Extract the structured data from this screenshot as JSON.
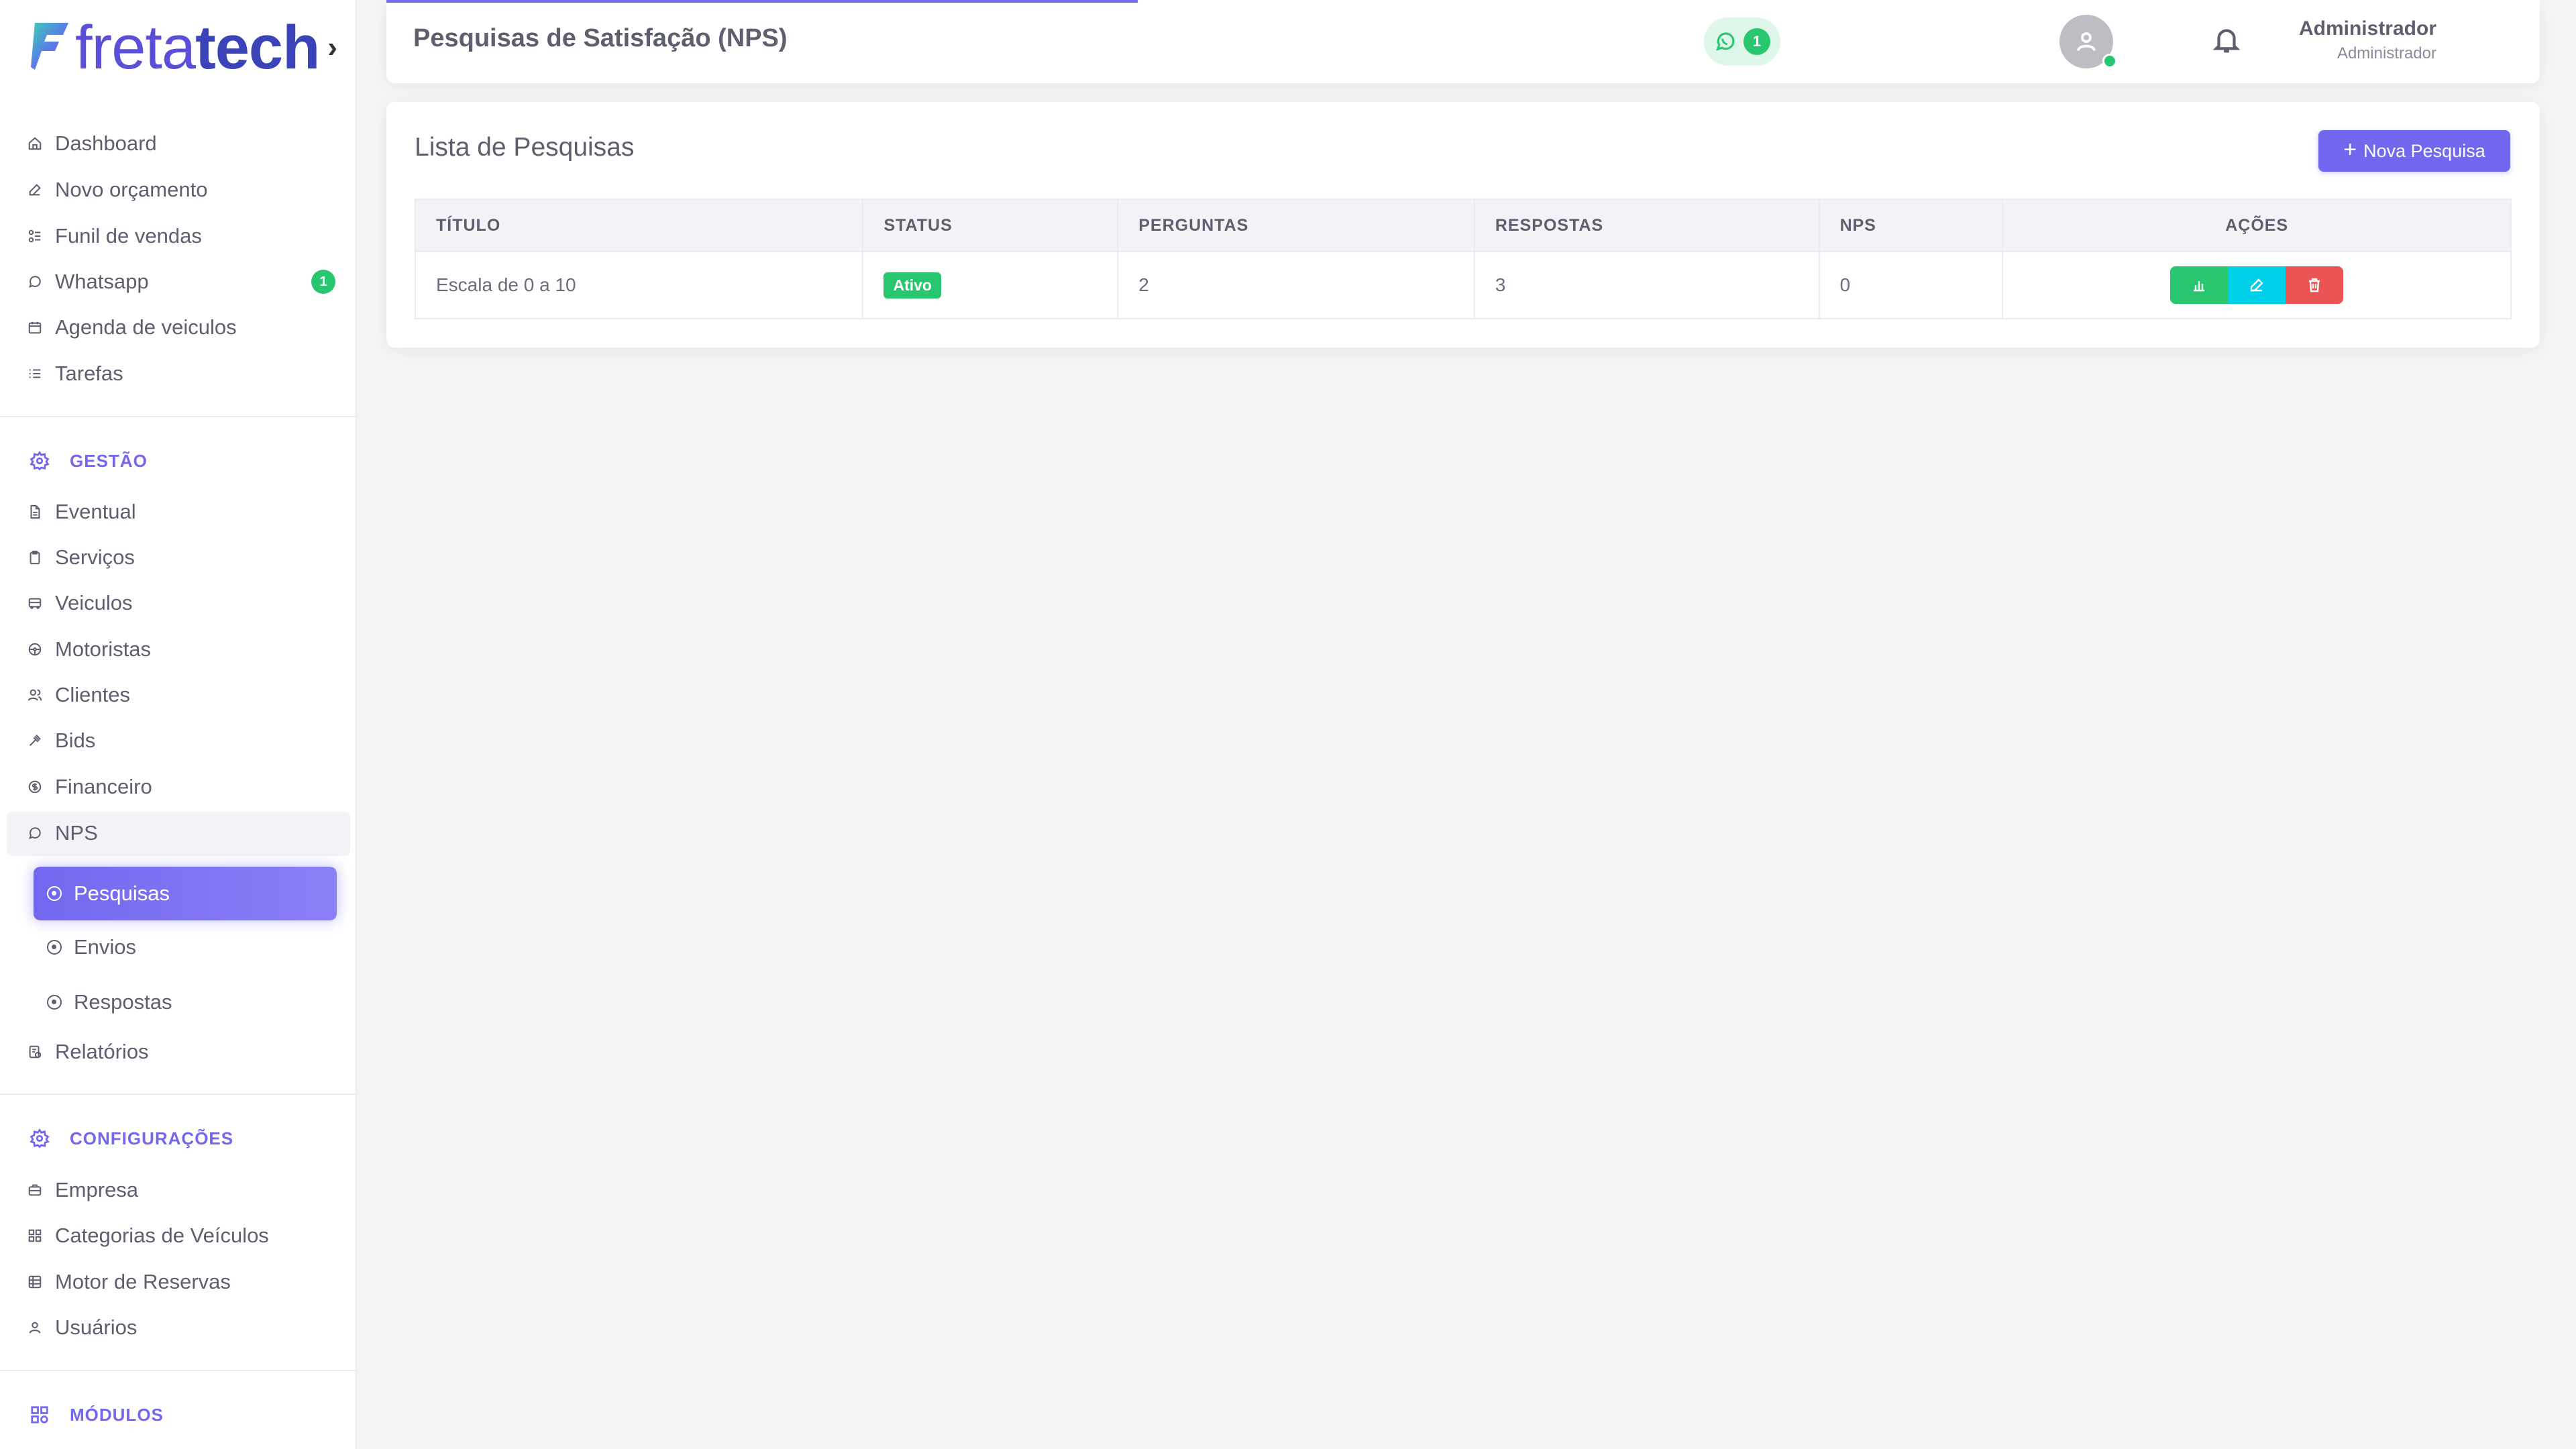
{
  "brand": {
    "logo_text_light": "freta",
    "logo_text_bold": "tech",
    "logo_chevron": "›"
  },
  "sidebar": {
    "main_items": [
      {
        "label": "Dashboard",
        "icon": "home-icon"
      },
      {
        "label": "Novo orçamento",
        "icon": "edit-icon"
      },
      {
        "label": "Funil de vendas",
        "icon": "funnel-icon"
      },
      {
        "label": "Whatsapp",
        "icon": "whatsapp-icon",
        "badge": "1"
      },
      {
        "label": "Agenda de veiculos",
        "icon": "calendar-icon"
      },
      {
        "label": "Tarefas",
        "icon": "list-icon"
      }
    ],
    "gestao": {
      "header": "GESTÃO",
      "items": [
        {
          "label": "Eventual",
          "icon": "file-icon"
        },
        {
          "label": "Serviços",
          "icon": "clipboard-icon"
        },
        {
          "label": "Veiculos",
          "icon": "bus-icon"
        },
        {
          "label": "Motoristas",
          "icon": "steering-wheel-icon"
        },
        {
          "label": "Clientes",
          "icon": "users-icon"
        },
        {
          "label": "Bids",
          "icon": "gavel-icon"
        },
        {
          "label": "Financeiro",
          "icon": "dollar-icon"
        },
        {
          "label": "NPS",
          "icon": "message-circle-icon"
        }
      ],
      "nps_sub": [
        {
          "label": "Pesquisas",
          "active": true
        },
        {
          "label": "Envios",
          "active": false
        },
        {
          "label": "Respostas",
          "active": false
        }
      ],
      "after": [
        {
          "label": "Relatórios",
          "icon": "report-icon"
        }
      ]
    },
    "config": {
      "header": "CONFIGURAÇÕES",
      "items": [
        {
          "label": "Empresa",
          "icon": "briefcase-icon"
        },
        {
          "label": "Categorias de Veículos",
          "icon": "grid-icon"
        },
        {
          "label": "Motor de Reservas",
          "icon": "table-icon"
        },
        {
          "label": "Usuários",
          "icon": "user-icon"
        }
      ]
    },
    "modulos": {
      "header": "MÓDULOS"
    }
  },
  "header": {
    "page_title": "Pesquisas de Satisfação (NPS)",
    "whatsapp_count": "1",
    "user_name": "Administrador",
    "user_role": "Administrador"
  },
  "card": {
    "title": "Lista de Pesquisas",
    "new_button": "Nova Pesquisa",
    "columns": [
      "TÍTULO",
      "STATUS",
      "PERGUNTAS",
      "RESPOSTAS",
      "NPS",
      "AÇÕES"
    ],
    "rows": [
      {
        "titulo": "Escala de 0 a 10",
        "status": "Ativo",
        "perguntas": "2",
        "respostas": "3",
        "nps": "0"
      }
    ]
  },
  "colors": {
    "accent": "#7367f0",
    "success": "#28c76f",
    "info": "#00cfe8",
    "danger": "#ea5455"
  }
}
